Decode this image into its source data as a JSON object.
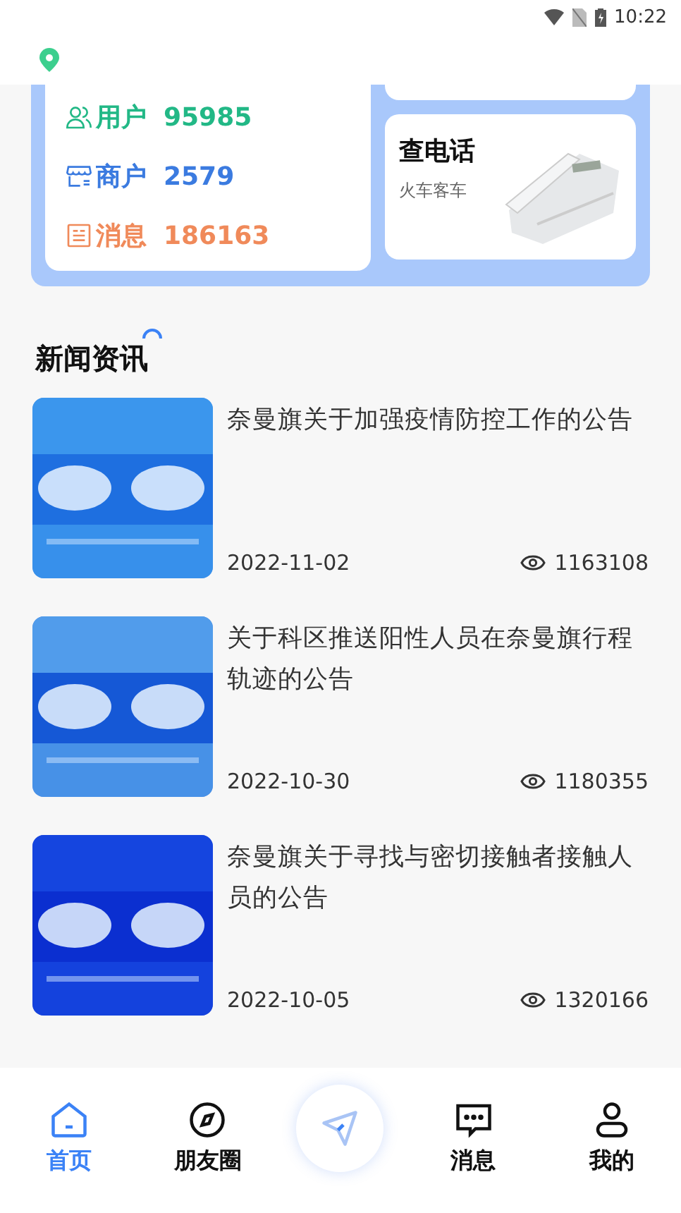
{
  "status_bar": {
    "time": "10:22"
  },
  "stats": [
    {
      "kind": "users",
      "label": "用户",
      "value": "95985",
      "color": "#22b886"
    },
    {
      "kind": "shops",
      "label": "商户",
      "value": "2579",
      "color": "#3b7be0"
    },
    {
      "kind": "messages",
      "label": "消息",
      "value": "186163",
      "color": "#f08a5a"
    }
  ],
  "phone_card": {
    "title": "查电话",
    "subtitle": "火车客车"
  },
  "news": {
    "title": "新闻资讯",
    "items": [
      {
        "title": "奈曼旗关于加强疫情防控工作的公告",
        "date": "2022-11-02",
        "views": "1163108",
        "kind": "picture"
      },
      {
        "title": "关于科区推送阳性人员在奈曼旗行程轨迹的公告",
        "date": "2022-10-30",
        "views": "1180355",
        "kind": "picture"
      },
      {
        "title": "奈曼旗关于寻找与密切接触者接触人员的公告",
        "date": "2022-10-05",
        "views": "1320166",
        "kind": "picture"
      }
    ]
  },
  "tab_bar": [
    {
      "kind": "home",
      "label": "首页",
      "selected": true
    },
    {
      "kind": "compass",
      "label": "朋友圈",
      "selected": false
    },
    {
      "kind": "center",
      "selected": false
    },
    {
      "kind": "chat",
      "label": "消息",
      "selected": false
    },
    {
      "kind": "user",
      "label": "我的",
      "selected": false
    }
  ]
}
